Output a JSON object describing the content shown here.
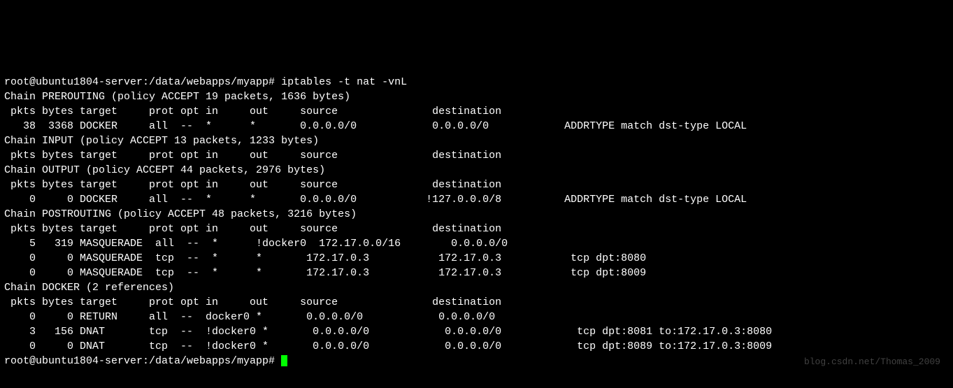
{
  "prompt_line": "root@ubuntu1804-server:/data/webapps/myapp# iptables -t nat -vnL",
  "prompt_user": "root",
  "prompt_host": "ubuntu1804-server",
  "prompt_cwd": "/data/webapps/myapp",
  "command": "iptables -t nat -vnL",
  "columns_header": " pkts bytes target     prot opt in     out     source               destination",
  "chains": [
    {
      "name": "PREROUTING",
      "policy": "ACCEPT",
      "packets": 19,
      "bytes": 1636,
      "title_line": "Chain PREROUTING (policy ACCEPT 19 packets, 1636 bytes)",
      "rules": [
        {
          "line": "   38  3368 DOCKER     all  --  *      *       0.0.0.0/0            0.0.0.0/0            ADDRTYPE match dst-type LOCAL",
          "pkts": 38,
          "bytes": 3368,
          "target": "DOCKER",
          "prot": "all",
          "opt": "--",
          "in": "*",
          "out": "*",
          "source": "0.0.0.0/0",
          "destination": "0.0.0.0/0",
          "extra": "ADDRTYPE match dst-type LOCAL"
        }
      ]
    },
    {
      "name": "INPUT",
      "policy": "ACCEPT",
      "packets": 13,
      "bytes": 1233,
      "title_line": "Chain INPUT (policy ACCEPT 13 packets, 1233 bytes)",
      "rules": []
    },
    {
      "name": "OUTPUT",
      "policy": "ACCEPT",
      "packets": 44,
      "bytes": 2976,
      "title_line": "Chain OUTPUT (policy ACCEPT 44 packets, 2976 bytes)",
      "rules": [
        {
          "line": "    0     0 DOCKER     all  --  *      *       0.0.0.0/0           !127.0.0.0/8          ADDRTYPE match dst-type LOCAL",
          "pkts": 0,
          "bytes": 0,
          "target": "DOCKER",
          "prot": "all",
          "opt": "--",
          "in": "*",
          "out": "*",
          "source": "0.0.0.0/0",
          "destination": "!127.0.0.0/8",
          "extra": "ADDRTYPE match dst-type LOCAL"
        }
      ]
    },
    {
      "name": "POSTROUTING",
      "policy": "ACCEPT",
      "packets": 48,
      "bytes": 3216,
      "title_line": "Chain POSTROUTING (policy ACCEPT 48 packets, 3216 bytes)",
      "rules": [
        {
          "line": "    5   319 MASQUERADE  all  --  *      !docker0  172.17.0.0/16        0.0.0.0/0",
          "pkts": 5,
          "bytes": 319,
          "target": "MASQUERADE",
          "prot": "all",
          "opt": "--",
          "in": "*",
          "out": "!docker0",
          "source": "172.17.0.0/16",
          "destination": "0.0.0.0/0",
          "extra": ""
        },
        {
          "line": "    0     0 MASQUERADE  tcp  --  *      *       172.17.0.3           172.17.0.3           tcp dpt:8080",
          "pkts": 0,
          "bytes": 0,
          "target": "MASQUERADE",
          "prot": "tcp",
          "opt": "--",
          "in": "*",
          "out": "*",
          "source": "172.17.0.3",
          "destination": "172.17.0.3",
          "extra": "tcp dpt:8080"
        },
        {
          "line": "    0     0 MASQUERADE  tcp  --  *      *       172.17.0.3           172.17.0.3           tcp dpt:8009",
          "pkts": 0,
          "bytes": 0,
          "target": "MASQUERADE",
          "prot": "tcp",
          "opt": "--",
          "in": "*",
          "out": "*",
          "source": "172.17.0.3",
          "destination": "172.17.0.3",
          "extra": "tcp dpt:8009"
        }
      ]
    },
    {
      "name": "DOCKER",
      "references": 2,
      "title_line": "Chain DOCKER (2 references)",
      "rules": [
        {
          "line": "    0     0 RETURN     all  --  docker0 *       0.0.0.0/0            0.0.0.0/0",
          "pkts": 0,
          "bytes": 0,
          "target": "RETURN",
          "prot": "all",
          "opt": "--",
          "in": "docker0",
          "out": "*",
          "source": "0.0.0.0/0",
          "destination": "0.0.0.0/0",
          "extra": ""
        },
        {
          "line": "    3   156 DNAT       tcp  --  !docker0 *       0.0.0.0/0            0.0.0.0/0            tcp dpt:8081 to:172.17.0.3:8080",
          "pkts": 3,
          "bytes": 156,
          "target": "DNAT",
          "prot": "tcp",
          "opt": "--",
          "in": "!docker0",
          "out": "*",
          "source": "0.0.0.0/0",
          "destination": "0.0.0.0/0",
          "extra": "tcp dpt:8081 to:172.17.0.3:8080"
        },
        {
          "line": "    0     0 DNAT       tcp  --  !docker0 *       0.0.0.0/0            0.0.0.0/0            tcp dpt:8089 to:172.17.0.3:8009",
          "pkts": 0,
          "bytes": 0,
          "target": "DNAT",
          "prot": "tcp",
          "opt": "--",
          "in": "!docker0",
          "out": "*",
          "source": "0.0.0.0/0",
          "destination": "0.0.0.0/0",
          "extra": "tcp dpt:8089 to:172.17.0.3:8009"
        }
      ]
    }
  ],
  "watermark": "blog.csdn.net/Thomas_2009"
}
